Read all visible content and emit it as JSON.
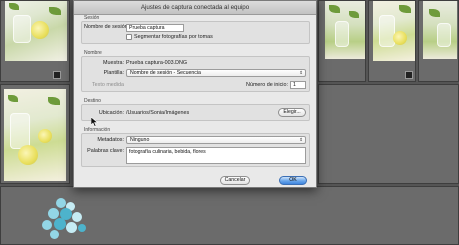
{
  "dialog": {
    "title": "Ajustes de captura conectada al equipo",
    "session": {
      "section": "Sesión",
      "name_label": "Nombre de sesión:",
      "name_value": "Prueba captura",
      "segment_label": "Segmentar fotografías por tomas",
      "segment_checked": false
    },
    "naming": {
      "section": "Nombre",
      "sample_label": "Muestra:",
      "sample_value": "Prueba captura-003.DNG",
      "template_label": "Plantilla:",
      "template_value": "Nombre de sesión - Secuencia",
      "custom_text_label": "Texto medida",
      "start_number_label": "Número de inicio:",
      "start_number_value": "1"
    },
    "destination": {
      "section": "Destino",
      "location_label": "Ubicación:",
      "location_value": "/Usuarios/Sonia/Imágenes",
      "choose_button": "Elegir..."
    },
    "information": {
      "section": "Información",
      "metadata_label": "Metadatos:",
      "metadata_value": "Ninguno",
      "keywords_label": "Palabras clave:",
      "keywords_value": "fotografía culinaria, bebida, flores"
    },
    "cancel_button": "Cancelar",
    "ok_button": "OK"
  },
  "icons": {
    "select_arrow": "⇕",
    "mouse_cursor": "cursor-arrow-icon",
    "logo": "flower-logo"
  },
  "colors": {
    "ok_button": "#4a8fe3",
    "logo_petal": "#93d6e6"
  }
}
